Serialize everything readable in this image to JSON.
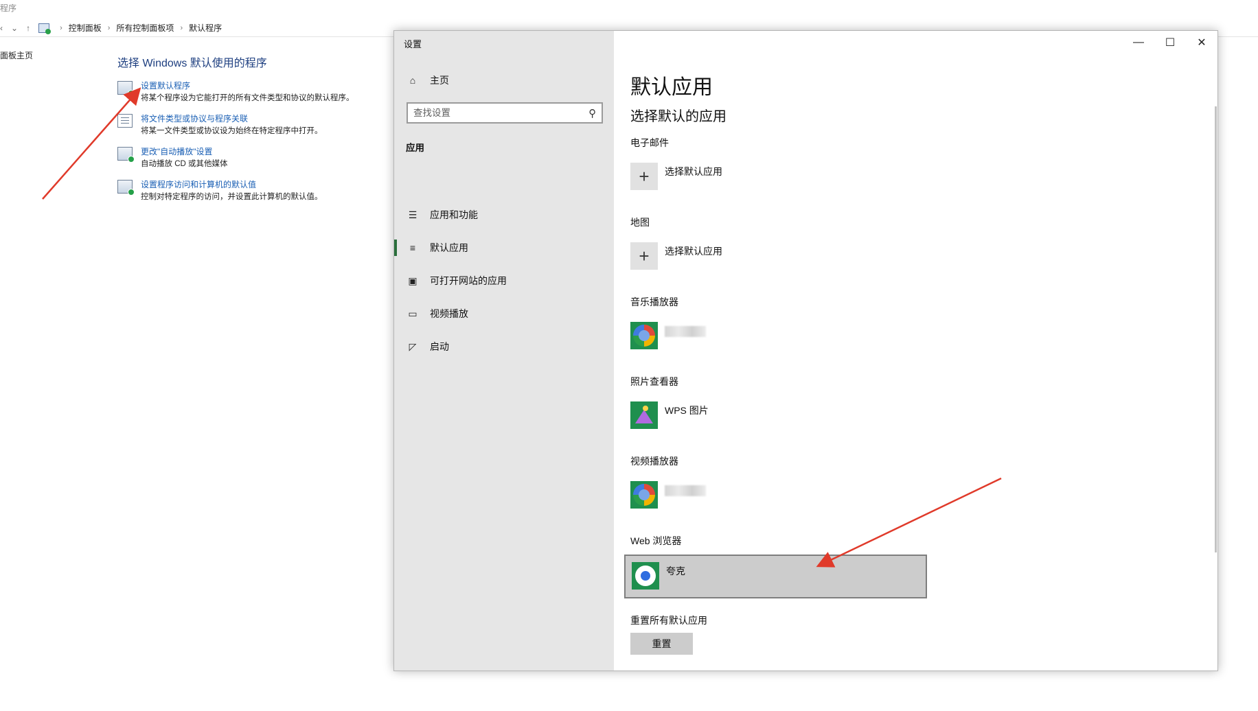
{
  "control_panel": {
    "title_fragment": "程序",
    "breadcrumb": [
      "控制面板",
      "所有控制面板项",
      "默认程序"
    ],
    "sidebar_link": "面板主页",
    "heading": "选择 Windows 默认使用的程序",
    "items": [
      {
        "link": "设置默认程序",
        "desc": "将某个程序设为它能打开的所有文件类型和协议的默认程序。"
      },
      {
        "link": "将文件类型或协议与程序关联",
        "desc": "将某一文件类型或协议设为始终在特定程序中打开。"
      },
      {
        "link": "更改\"自动播放\"设置",
        "desc": "自动播放 CD 或其他媒体"
      },
      {
        "link": "设置程序访问和计算机的默认值",
        "desc": "控制对特定程序的访问，并设置此计算机的默认值。"
      }
    ]
  },
  "settings": {
    "window_title": "设置",
    "window_controls": {
      "minimize": "—",
      "maximize": "☐",
      "close": "✕"
    },
    "nav_home": "主页",
    "search_placeholder": "查找设置",
    "section_label": "应用",
    "nav_items": [
      {
        "label": "应用和功能",
        "icon": "list-icon"
      },
      {
        "label": "默认应用",
        "icon": "default-apps-icon",
        "active": true
      },
      {
        "label": "可打开网站的应用",
        "icon": "web-apps-icon"
      },
      {
        "label": "视频播放",
        "icon": "video-icon"
      },
      {
        "label": "启动",
        "icon": "startup-icon"
      }
    ],
    "page_title": "默认应用",
    "page_subtitle": "选择默认的应用",
    "categories": [
      {
        "label": "电子邮件",
        "app": "选择默认应用",
        "icon": "plus-icon"
      },
      {
        "label": "地图",
        "app": "选择默认应用",
        "icon": "plus-icon"
      },
      {
        "label": "音乐播放器",
        "app": "",
        "icon": "media-player-icon"
      },
      {
        "label": "照片查看器",
        "app": "WPS 图片",
        "icon": "wps-photo-icon"
      },
      {
        "label": "视频播放器",
        "app": "",
        "icon": "media-player-icon"
      },
      {
        "label": "Web 浏览器",
        "app": "夸克",
        "icon": "quark-browser-icon"
      }
    ],
    "reset": {
      "label": "重置所有默认应用",
      "button": "重置"
    }
  },
  "colors": {
    "accent_bar": "#2a6f3c",
    "link_blue": "#1a5fb4",
    "annotation_red": "#e03a2a"
  }
}
